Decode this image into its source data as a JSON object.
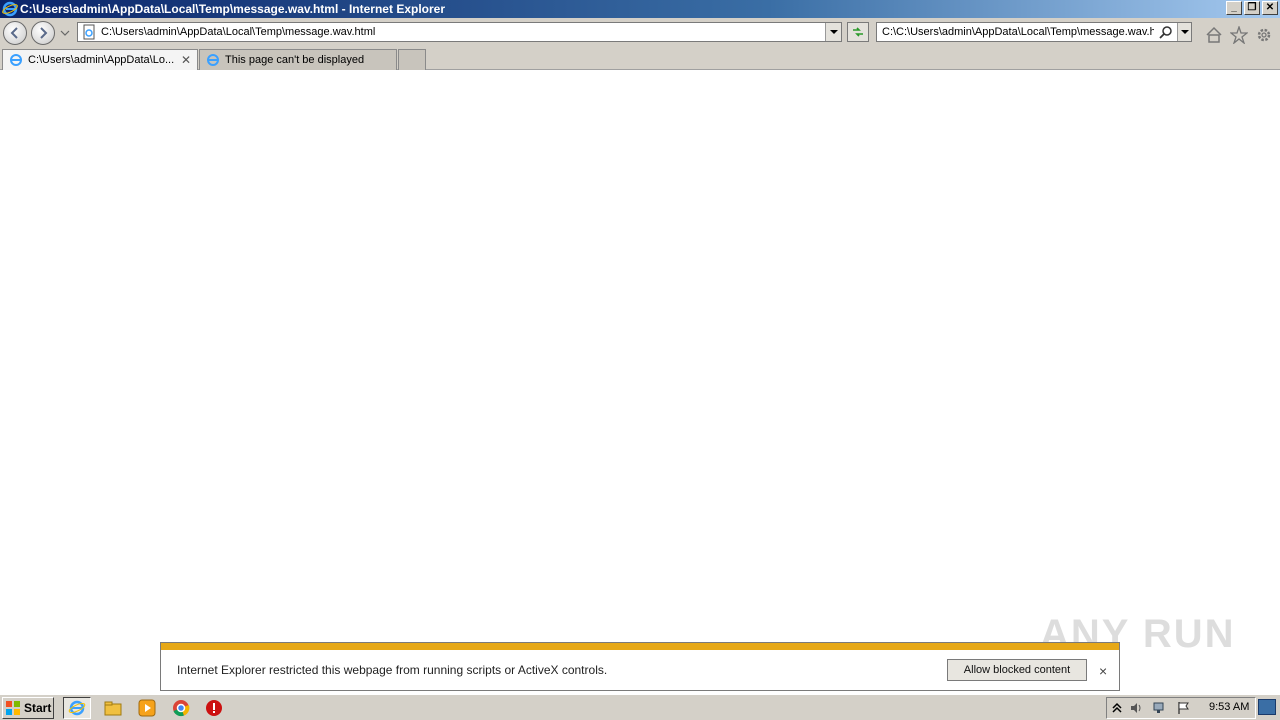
{
  "window": {
    "title": "C:\\Users\\admin\\AppData\\Local\\Temp\\message.wav.html - Internet Explorer",
    "controls": {
      "minimize": "_",
      "restore": "❐",
      "close": "✕"
    }
  },
  "navbar": {
    "address": "C:\\Users\\admin\\AppData\\Local\\Temp\\message.wav.html",
    "search_value": "C:\\C:\\Users\\admin\\AppData\\Local\\Temp\\message.wav.h",
    "icons": [
      "back-icon",
      "forward-icon",
      "refresh-icon",
      "search-icon",
      "home-icon",
      "favorites-icon",
      "settings-icon"
    ]
  },
  "tabs": [
    {
      "label": "C:\\Users\\admin\\AppData\\Lo...",
      "active": true
    },
    {
      "label": "This page can't be displayed",
      "active": false
    }
  ],
  "notification": {
    "message": "Internet Explorer restricted this webpage from running scripts or ActiveX controls.",
    "allow_label": "Allow blocked content",
    "close": "×",
    "stripe_color": "#e6a817"
  },
  "watermark": "ANY RUN",
  "taskbar": {
    "start_label": "Start",
    "clock": "9:53 AM",
    "apps": [
      "internet-explorer-icon",
      "file-explorer-icon",
      "media-player-icon",
      "chrome-icon",
      "stop-icon"
    ]
  },
  "colors": {
    "titlebar_start": "#0a246a",
    "accent_orange": "#e6a817"
  }
}
